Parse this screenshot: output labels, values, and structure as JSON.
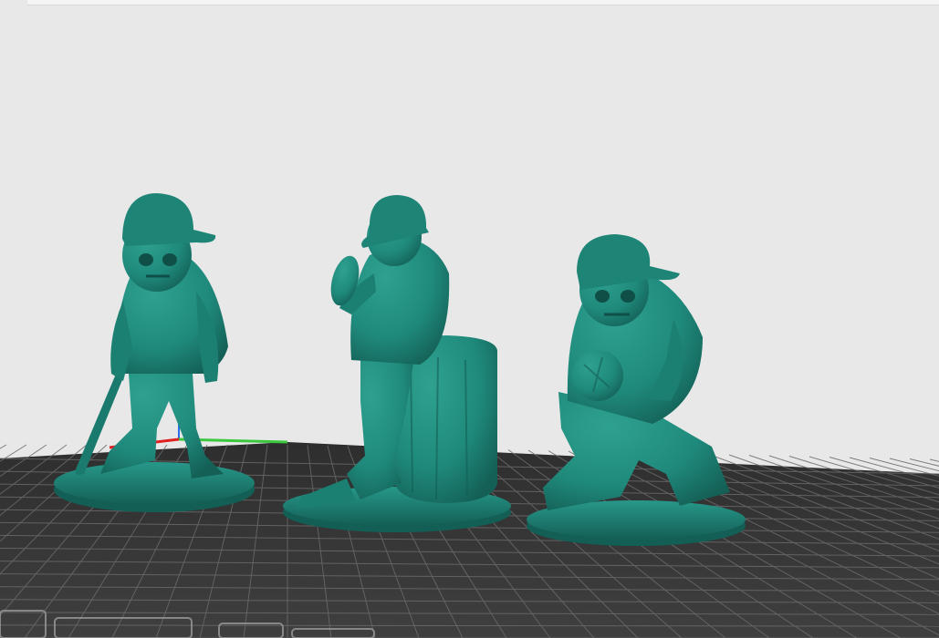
{
  "app": {
    "view": "3d-print-viewport",
    "background_color": "#e8e8e8",
    "bed_color": "#3b3b3b",
    "grid_line_color": "#6a6a6a",
    "model_color": "#1f8a7c",
    "model_highlight_color": "#34a594",
    "model_shadow_color": "#135e55"
  },
  "axes": {
    "x_color": "#e02020",
    "y_color": "#3cc83c",
    "z_color": "#2a6fe8"
  },
  "models": [
    {
      "id": "figure-1",
      "pose": "standing-with-bat"
    },
    {
      "id": "figure-2",
      "pose": "leaning-on-post-with-football"
    },
    {
      "id": "figure-3",
      "pose": "kneeling-with-ball"
    }
  ],
  "bottom_toolbar": {
    "icons": [
      "left-panel-icon",
      "layout-icon",
      "view-icon",
      "object-icon"
    ]
  }
}
